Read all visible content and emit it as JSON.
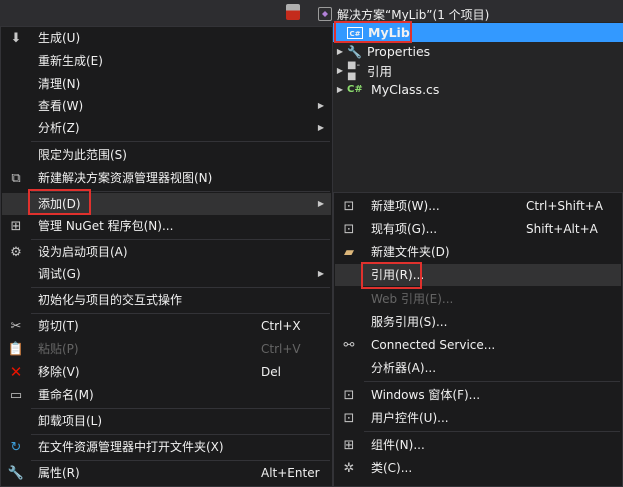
{
  "solution_explorer": {
    "header": "解决方案“MyLib”(1 个项目)",
    "items": [
      {
        "label": "MyLib",
        "icon": "csharp-project-icon"
      },
      {
        "label": "Properties",
        "icon": "wrench-icon"
      },
      {
        "label": "引用",
        "icon": "references-icon"
      },
      {
        "label": "MyClass.cs",
        "icon": "csharp-file-icon",
        "prefix": "C#"
      }
    ]
  },
  "context_menu": {
    "items": [
      {
        "label": "生成(U)"
      },
      {
        "label": "重新生成(E)"
      },
      {
        "label": "清理(N)"
      },
      {
        "label": "查看(W)"
      },
      {
        "label": "分析(Z)"
      },
      {
        "label": "限定为此范围(S)"
      },
      {
        "label": "新建解决方案资源管理器视图(N)"
      },
      {
        "label": "添加(D)"
      },
      {
        "label": "管理 NuGet 程序包(N)..."
      },
      {
        "label": "设为启动项目(A)"
      },
      {
        "label": "调试(G)"
      },
      {
        "label": "初始化与项目的交互式操作"
      },
      {
        "label": "剪切(T)",
        "shortcut": "Ctrl+X"
      },
      {
        "label": "粘贴(P)",
        "shortcut": "Ctrl+V"
      },
      {
        "label": "移除(V)",
        "shortcut": "Del"
      },
      {
        "label": "重命名(M)"
      },
      {
        "label": "卸载项目(L)"
      },
      {
        "label": "在文件资源管理器中打开文件夹(X)"
      },
      {
        "label": "属性(R)",
        "shortcut": "Alt+Enter"
      }
    ]
  },
  "submenu": {
    "items": [
      {
        "label": "新建项(W)...",
        "shortcut": "Ctrl+Shift+A"
      },
      {
        "label": "现有项(G)...",
        "shortcut": "Shift+Alt+A"
      },
      {
        "label": "新建文件夹(D)"
      },
      {
        "label": "引用(R)..."
      },
      {
        "label": "Web 引用(E)..."
      },
      {
        "label": "服务引用(S)..."
      },
      {
        "label": "Connected Service..."
      },
      {
        "label": "分析器(A)..."
      },
      {
        "label": "Windows 窗体(F)..."
      },
      {
        "label": "用户控件(U)..."
      },
      {
        "label": "组件(N)..."
      },
      {
        "label": "类(C)..."
      }
    ]
  },
  "colors": {
    "selection": "#3399ff",
    "highlight_box": "#e0312d",
    "menu_bg": "#1b1b1c",
    "remove_icon": "#e51400"
  }
}
